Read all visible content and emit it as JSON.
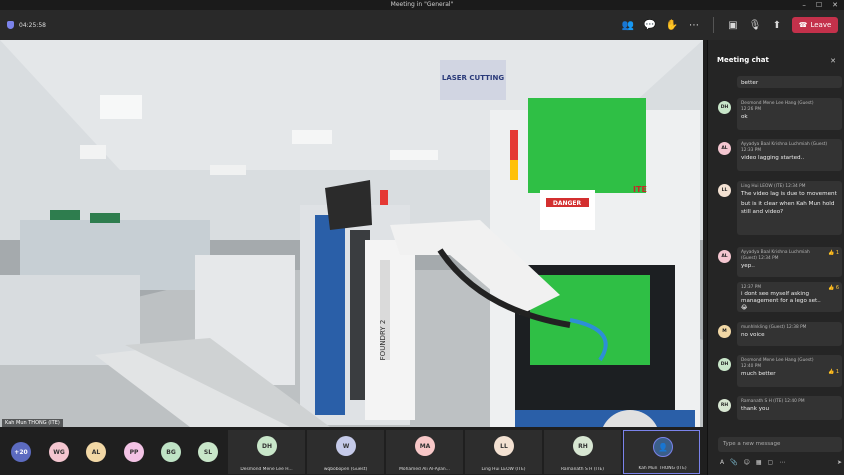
{
  "window": {
    "title": "Meeting in \"General\""
  },
  "toolbar": {
    "timer": "04:25:58",
    "leave_label": "Leave",
    "colors": {
      "leave_button": "#c4314b",
      "accent": "#7b83eb"
    }
  },
  "video": {
    "speaker_label": "Kah Mun THONG (ITE)",
    "sign_text": "LASER CUTTING",
    "danger_text": "DANGER",
    "robot_text": "FOUNDRY 2",
    "brand_text": "ITE"
  },
  "participants": {
    "overflow": "+20",
    "small": [
      {
        "initials": "WG",
        "color": "#f4c6d0"
      },
      {
        "initials": "AL",
        "color": "#f2d8a6"
      },
      {
        "initials": "PP",
        "color": "#f3c3e5"
      },
      {
        "initials": "BG",
        "color": "#bfe3c5"
      },
      {
        "initials": "SL",
        "color": "#c8e6c9"
      }
    ],
    "tiles": [
      {
        "initials": "DH",
        "name": "Desmond Mene Lee H...",
        "color": "#c8e6c9"
      },
      {
        "initials": "W",
        "name": "wqbobopen (Guest)",
        "color": "#c5cae9"
      },
      {
        "initials": "MA",
        "name": "Mohamed Ali Al-Ajlan...",
        "color": "#f8c8c8"
      },
      {
        "initials": "LL",
        "name": "Ling Hui LEOW (ITE)",
        "color": "#f3e1d2"
      },
      {
        "initials": "RH",
        "name": "Ramanath S H (ITE)",
        "color": "#d7e6d2"
      },
      {
        "initials": "",
        "name": "Kah Mun THONG (ITE)",
        "color": "#3b5f8a"
      }
    ]
  },
  "chat": {
    "title": "Meeting chat",
    "compose_placeholder": "Type a new message",
    "messages": [
      {
        "author": "",
        "time": "",
        "text": [
          "better"
        ],
        "initials": "",
        "color": ""
      },
      {
        "author": "Desmond Mene Lee Hang (Guest)",
        "time": "12:26 PM",
        "text": [
          "ok"
        ],
        "initials": "DH",
        "color": "#c8e6c9"
      },
      {
        "author": "Ayyadya Baal Krishna Luchmiah (Guest)",
        "time": "12:33 PM",
        "text": [
          "video lagging started.."
        ],
        "initials": "AL",
        "color": "#f4c6d0"
      },
      {
        "author": "Ling Hui LEOW (ITE)",
        "time": "12:34 PM",
        "text": [
          "The video lag is due to movement",
          "but is it clear when Kah Mun hold still and video?"
        ],
        "initials": "LL",
        "color": "#f3e1d2"
      },
      {
        "author": "Ayyadya Baal Krishna Luchmiah (Guest)",
        "time": "12:34 PM",
        "text": [
          "yep.."
        ],
        "initials": "AL",
        "color": "#f4c6d0",
        "reaction": "👍 1"
      },
      {
        "author": "",
        "time": "12:37 PM",
        "text": [
          "i dont see myself asking management for a lego set.. 😂"
        ],
        "initials": "",
        "color": "",
        "reaction": "👍 6"
      },
      {
        "author": "munhlnkling (Guest)",
        "time": "12:38 PM",
        "text": [
          "no voice"
        ],
        "initials": "M",
        "color": "#f2d8a6"
      },
      {
        "author": "Desmond Mene Lee Hang (Guest)",
        "time": "12:40 PM",
        "text": [
          "much better"
        ],
        "initials": "DH",
        "color": "#c8e6c9",
        "reaction": "👍 1"
      },
      {
        "author": "Ramanath S H (ITE)",
        "time": "12:40 PM",
        "text": [
          "thank you"
        ],
        "initials": "RH",
        "color": "#d7e6d2"
      }
    ]
  }
}
